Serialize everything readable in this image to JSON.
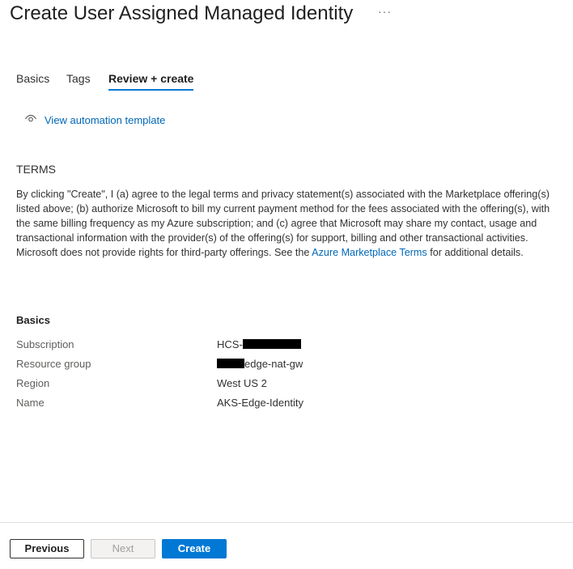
{
  "header": {
    "title": "Create User Assigned Managed Identity",
    "more_label": "···"
  },
  "tabs": [
    {
      "label": "Basics",
      "active": false
    },
    {
      "label": "Tags",
      "active": false
    },
    {
      "label": "Review + create",
      "active": true
    }
  ],
  "automation": {
    "icon": "eye-icon",
    "link_label": "View automation template"
  },
  "terms": {
    "heading": "TERMS",
    "body_before_link": "By clicking \"Create\", I (a) agree to the legal terms and privacy statement(s) associated with the Marketplace offering(s) listed above; (b) authorize Microsoft to bill my current payment method for the fees associated with the offering(s), with the same billing frequency as my Azure subscription; and (c) agree that Microsoft may share my contact, usage and transactional information with the provider(s) of the offering(s) for support, billing and other transactional activities. Microsoft does not provide rights for third-party offerings. See the ",
    "link_label": "Azure Marketplace Terms",
    "body_after_link": " for additional details."
  },
  "basics": {
    "heading": "Basics",
    "rows": [
      {
        "label": "Subscription",
        "value_prefix": "HCS-",
        "value_suffix": ""
      },
      {
        "label": "Resource group",
        "value_prefix": "",
        "value_suffix": "edge-nat-gw"
      },
      {
        "label": "Region",
        "value": "West US 2"
      },
      {
        "label": "Name",
        "value": "AKS-Edge-Identity"
      }
    ]
  },
  "footer": {
    "previous_label": "Previous",
    "next_label": "Next",
    "create_label": "Create"
  },
  "colors": {
    "accent": "#0078d4",
    "link": "#0067b8",
    "disabled_bg": "#f3f2f1"
  }
}
